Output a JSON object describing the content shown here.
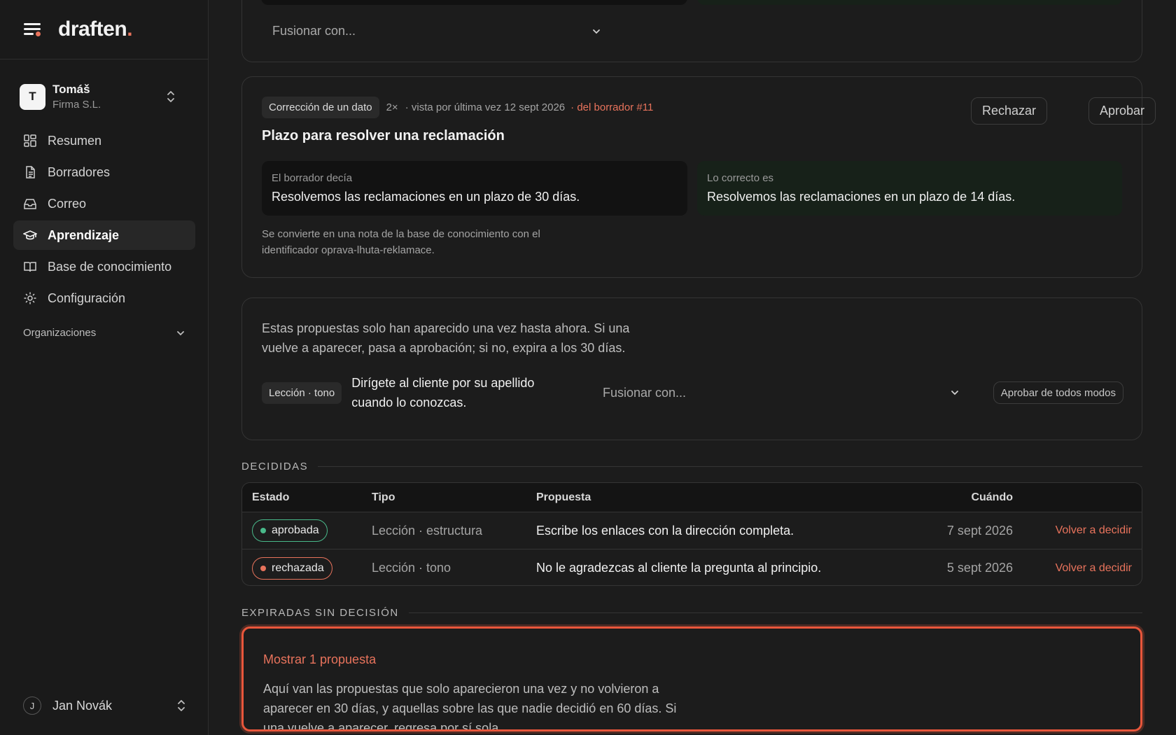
{
  "brand": {
    "name": "draften",
    "dot": "."
  },
  "org": {
    "initial": "T",
    "name": "Tomáš",
    "subtitle": "Firma S.L."
  },
  "nav": [
    {
      "label": "Resumen",
      "icon": "dashboard-icon"
    },
    {
      "label": "Borradores",
      "icon": "document-icon"
    },
    {
      "label": "Correo",
      "icon": "inbox-icon"
    },
    {
      "label": "Aprendizaje",
      "icon": "graduation-cap-icon",
      "active": true
    },
    {
      "label": "Base de conocimiento",
      "icon": "book-icon"
    },
    {
      "label": "Configuración",
      "icon": "gear-icon"
    }
  ],
  "organizations_label": "Organizaciones",
  "user": {
    "initial": "J",
    "name": "Jan Novák"
  },
  "top_card": {
    "merge_placeholder": "Fusionar con..."
  },
  "fix_card": {
    "tag": "Corrección de un dato",
    "count": "2×",
    "seen": "· vista por última vez 12 sept 2026",
    "source": "· del borrador #11",
    "title": "Plazo para resolver una reclamación",
    "reject_label": "Rechazar",
    "approve_label": "Aprobar",
    "old_label": "El borrador decía",
    "old_text": "Resolvemos las reclamaciones en un plazo de 30 días.",
    "new_label": "Lo correcto es",
    "new_text": "Resolvemos las reclamaciones en un plazo de 14 días.",
    "note": "Se convierte en una nota de la base de conocimiento con el identificador oprava-lhuta-reklamace."
  },
  "pending_card": {
    "description": "Estas propuestas solo han aparecido una vez hasta ahora. Si una vuelve a aparecer, pasa a aprobación; si no, expira a los 30 días.",
    "tag": "Lección · tono",
    "lesson": "Dirígete al cliente por su apellido cuando lo conozcas.",
    "merge_placeholder": "Fusionar con...",
    "approve_anyway_label": "Aprobar de todos modos"
  },
  "decided": {
    "heading": "DECIDIDAS",
    "columns": {
      "state": "Estado",
      "type": "Tipo",
      "proposal": "Propuesta",
      "when": "Cuándo"
    },
    "rows": [
      {
        "state": "aprobada",
        "type": "Lección · estructura",
        "proposal": "Escribe los enlaces con la dirección completa.",
        "when": "7 sept 2026",
        "action": "Volver a decidir"
      },
      {
        "state": "rechazada",
        "type": "Lección · tono",
        "proposal": "No le agradezcas al cliente la pregunta al principio.",
        "when": "5 sept 2026",
        "action": "Volver a decidir"
      }
    ]
  },
  "expired": {
    "heading": "EXPIRADAS SIN DECISIÓN",
    "show_link": "Mostrar 1 propuesta",
    "description": "Aquí van las propuestas que solo aparecieron una vez y no volvieron a aparecer en 30 días, y aquellas sobre las que nadie decidió en 60 días. Si una vuelve a aparecer, regresa por sí sola."
  },
  "colors": {
    "accent": "#e8735c",
    "approved": "#49b98a",
    "highlight_border": "#e8563b",
    "correct_bg": "#172119"
  }
}
